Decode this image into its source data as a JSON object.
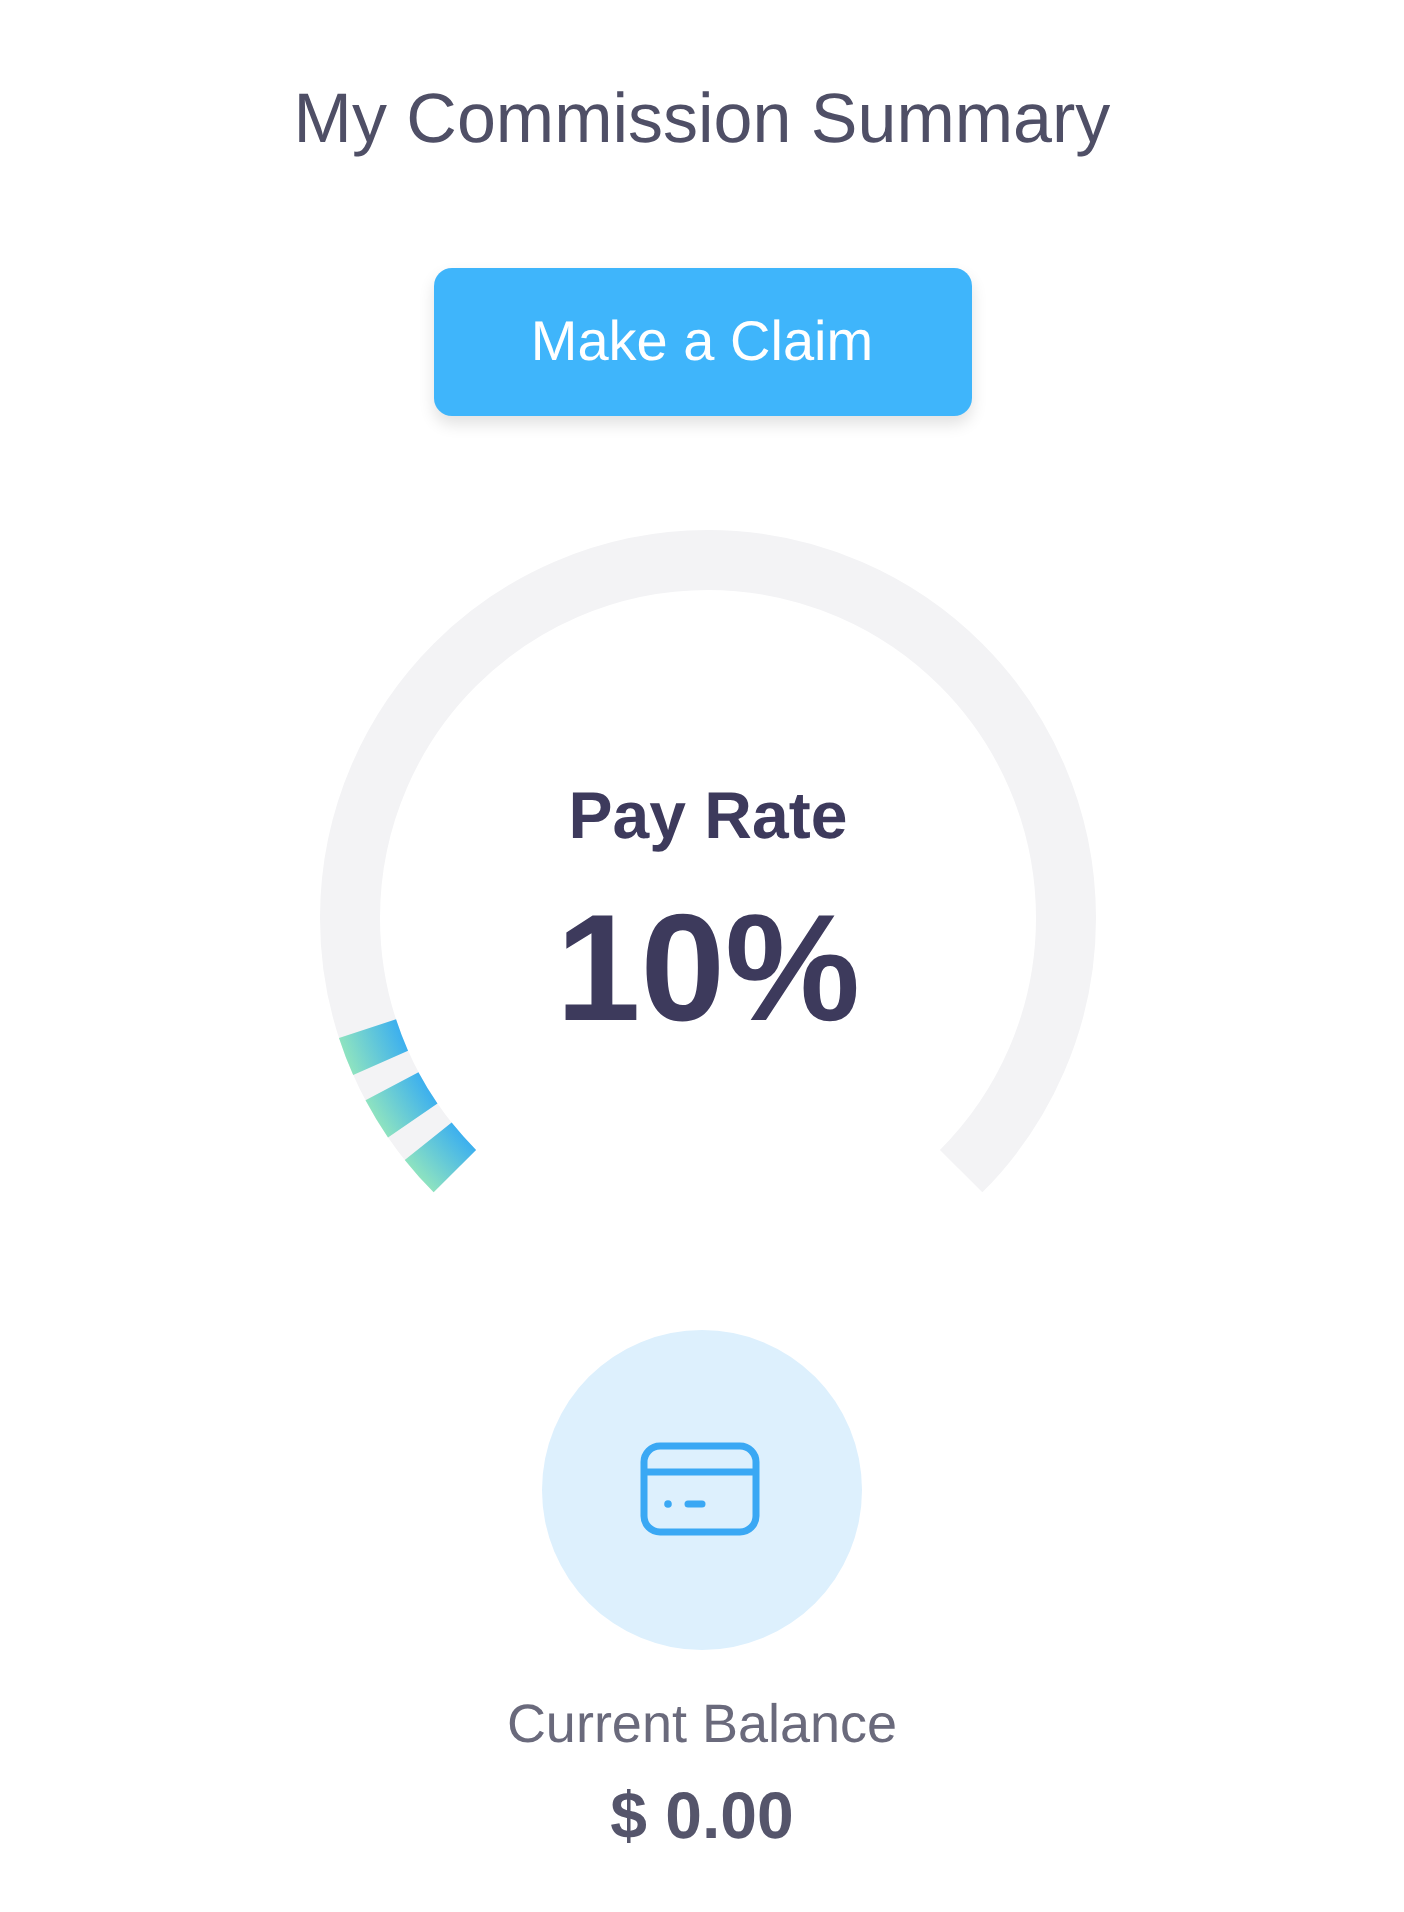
{
  "title": "My Commission Summary",
  "claim_button": {
    "label": "Make a Claim"
  },
  "gauge": {
    "label": "Pay Rate",
    "reading": "10%",
    "level": 0.1
  },
  "balance": {
    "label": "Current Balance",
    "amount": "$ 0.00"
  }
}
